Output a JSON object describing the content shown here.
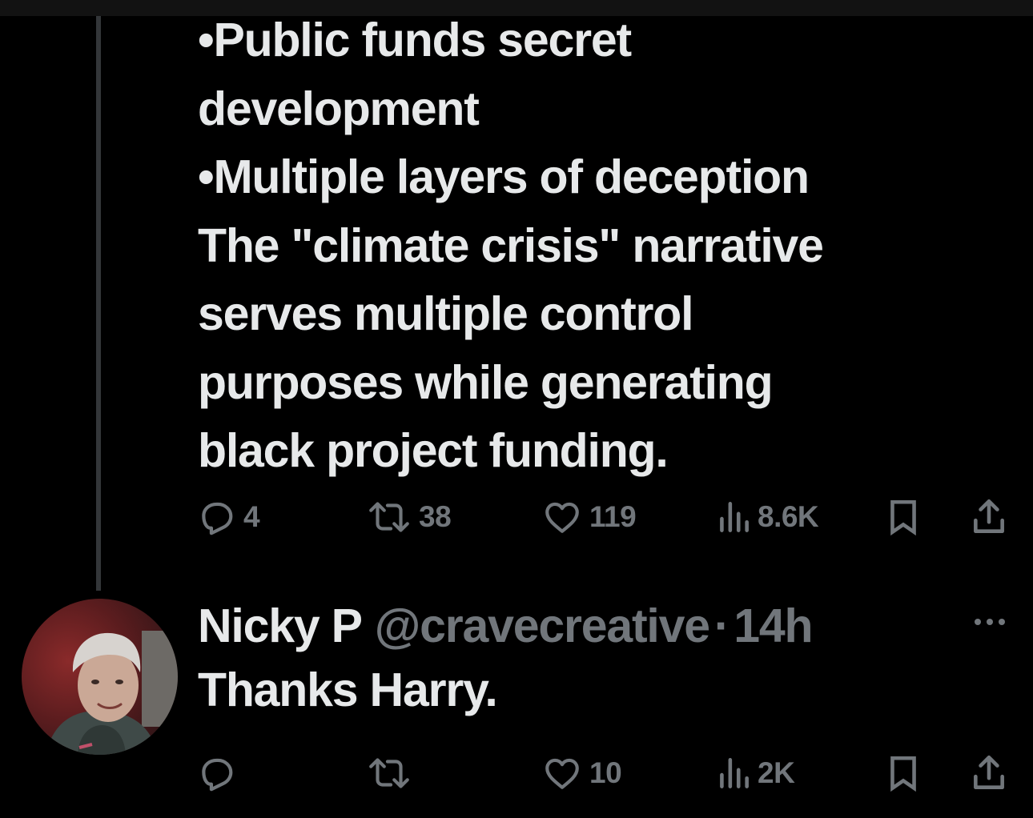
{
  "thread_tweet": {
    "text_lines": [
      "•Public funds secret",
      "development",
      "•Multiple layers of deception",
      "The \"climate crisis\" narrative",
      "serves multiple control",
      "purposes while generating",
      "black project funding."
    ],
    "actions": {
      "replies": "4",
      "reposts": "38",
      "likes": "119",
      "views": "8.6K"
    }
  },
  "reply": {
    "name": "Nicky P",
    "handle": "@cravecreative",
    "separator": "·",
    "time": "14h",
    "text": "Thanks Harry.",
    "actions": {
      "replies": "",
      "reposts": "",
      "likes": "10",
      "views": "2K"
    }
  },
  "icons": {
    "reply": "reply-icon",
    "repost": "repost-icon",
    "like": "heart-icon",
    "views": "views-icon",
    "bookmark": "bookmark-icon",
    "share": "share-icon",
    "more": "more-icon"
  },
  "colors": {
    "background": "#000000",
    "text_primary": "#e7e9ea",
    "text_secondary": "#71767b",
    "thread_line": "#333639"
  }
}
